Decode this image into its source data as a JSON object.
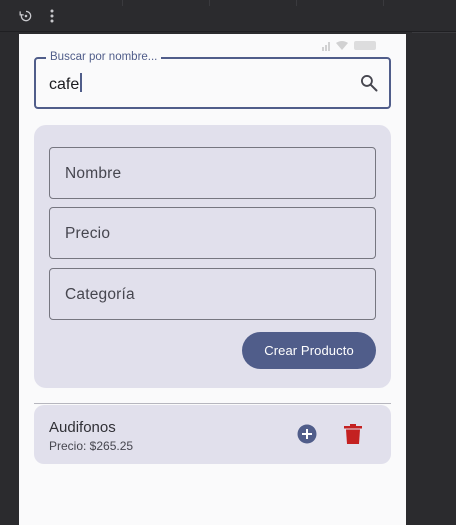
{
  "search": {
    "label": "Buscar por nombre...",
    "value": "cafe"
  },
  "form": {
    "name_placeholder": "Nombre",
    "price_placeholder": "Precio",
    "category_placeholder": "Categoría",
    "create_label": "Crear Producto"
  },
  "products": [
    {
      "name": "Audifonos",
      "price": "Precio: $265.25"
    }
  ],
  "icons": {
    "toolbar": [
      "rotate-icon",
      "more-vert-icon"
    ],
    "search": "search-icon",
    "add": "add-circle-icon",
    "delete": "trash-icon"
  },
  "colors": {
    "primary": "#505d8a",
    "surface_variant": "#e1e0ec",
    "delete": "#c42121"
  }
}
